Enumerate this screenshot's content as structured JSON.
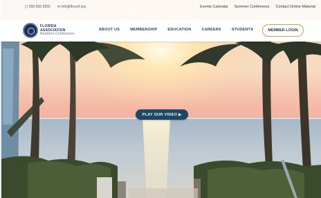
{
  "topbar": {
    "phone": "( ) 555-555-5555",
    "email": "✉ info@flrconf.org",
    "links": [
      "Events Calendar",
      "Summer Conference",
      "Contact Online Material"
    ]
  },
  "logo": {
    "name": "FLORIDA ASSOCIATION",
    "tagline": "Realtors Conference"
  },
  "nav": {
    "items": [
      "ABOUT US",
      "MEMBERSHIP",
      "EDUCATION",
      "CAREERS",
      "STUDENTS"
    ],
    "member_login": "MEMBER LOGIN"
  },
  "hero": {
    "play_label": "PLAY OUR VIDEO ▶"
  }
}
